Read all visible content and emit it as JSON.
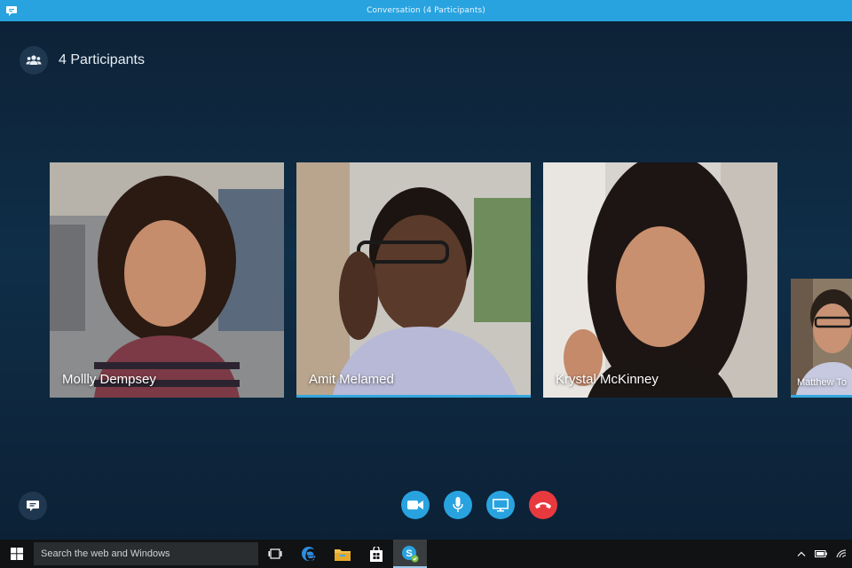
{
  "window": {
    "title": "Conversation (4 Participants)"
  },
  "header": {
    "participants_label": "4 Participants"
  },
  "participants": [
    {
      "name": "Mollly Dempsey",
      "speaking": false
    },
    {
      "name": "Amit Melamed",
      "speaking": true
    },
    {
      "name": "Krystal McKinney",
      "speaking": false
    },
    {
      "name": "Matthew To",
      "speaking": true
    }
  ],
  "controls": {
    "video": "video-camera-icon",
    "mic": "microphone-icon",
    "share": "screen-share-icon",
    "hangup": "hang-up-icon"
  },
  "taskbar": {
    "search_placeholder": "Search the web and Windows"
  },
  "colors": {
    "accent": "#29a3df",
    "hangup": "#e8393f",
    "background": "#0c1d2e",
    "speaking_bar": "#33a6dd"
  }
}
